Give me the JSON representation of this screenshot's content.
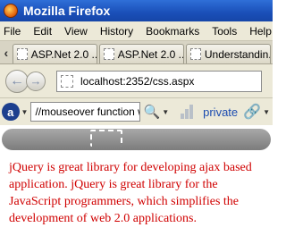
{
  "window": {
    "title": "Mozilla Firefox"
  },
  "menu": [
    "File",
    "Edit",
    "View",
    "History",
    "Bookmarks",
    "Tools",
    "Help"
  ],
  "tabs": [
    {
      "label": "ASP.Net 2.0 ..."
    },
    {
      "label": "ASP.Net 2.0 ..."
    },
    {
      "label": "Understandin..."
    }
  ],
  "nav": {
    "url": "localhost:2352/css.aspx"
  },
  "toolbar": {
    "search_value": "//mouseover function wi",
    "private_label": "private",
    "ask_icon": "a"
  },
  "content": {
    "paragraph": " jQuery is great library for developing ajax based application. jQuery is great library for the JavaScript programmers, which simplifies the development of web 2.0 applications."
  },
  "colors": {
    "content_text": "#d00000",
    "titlebar": "#1a4fb8"
  }
}
